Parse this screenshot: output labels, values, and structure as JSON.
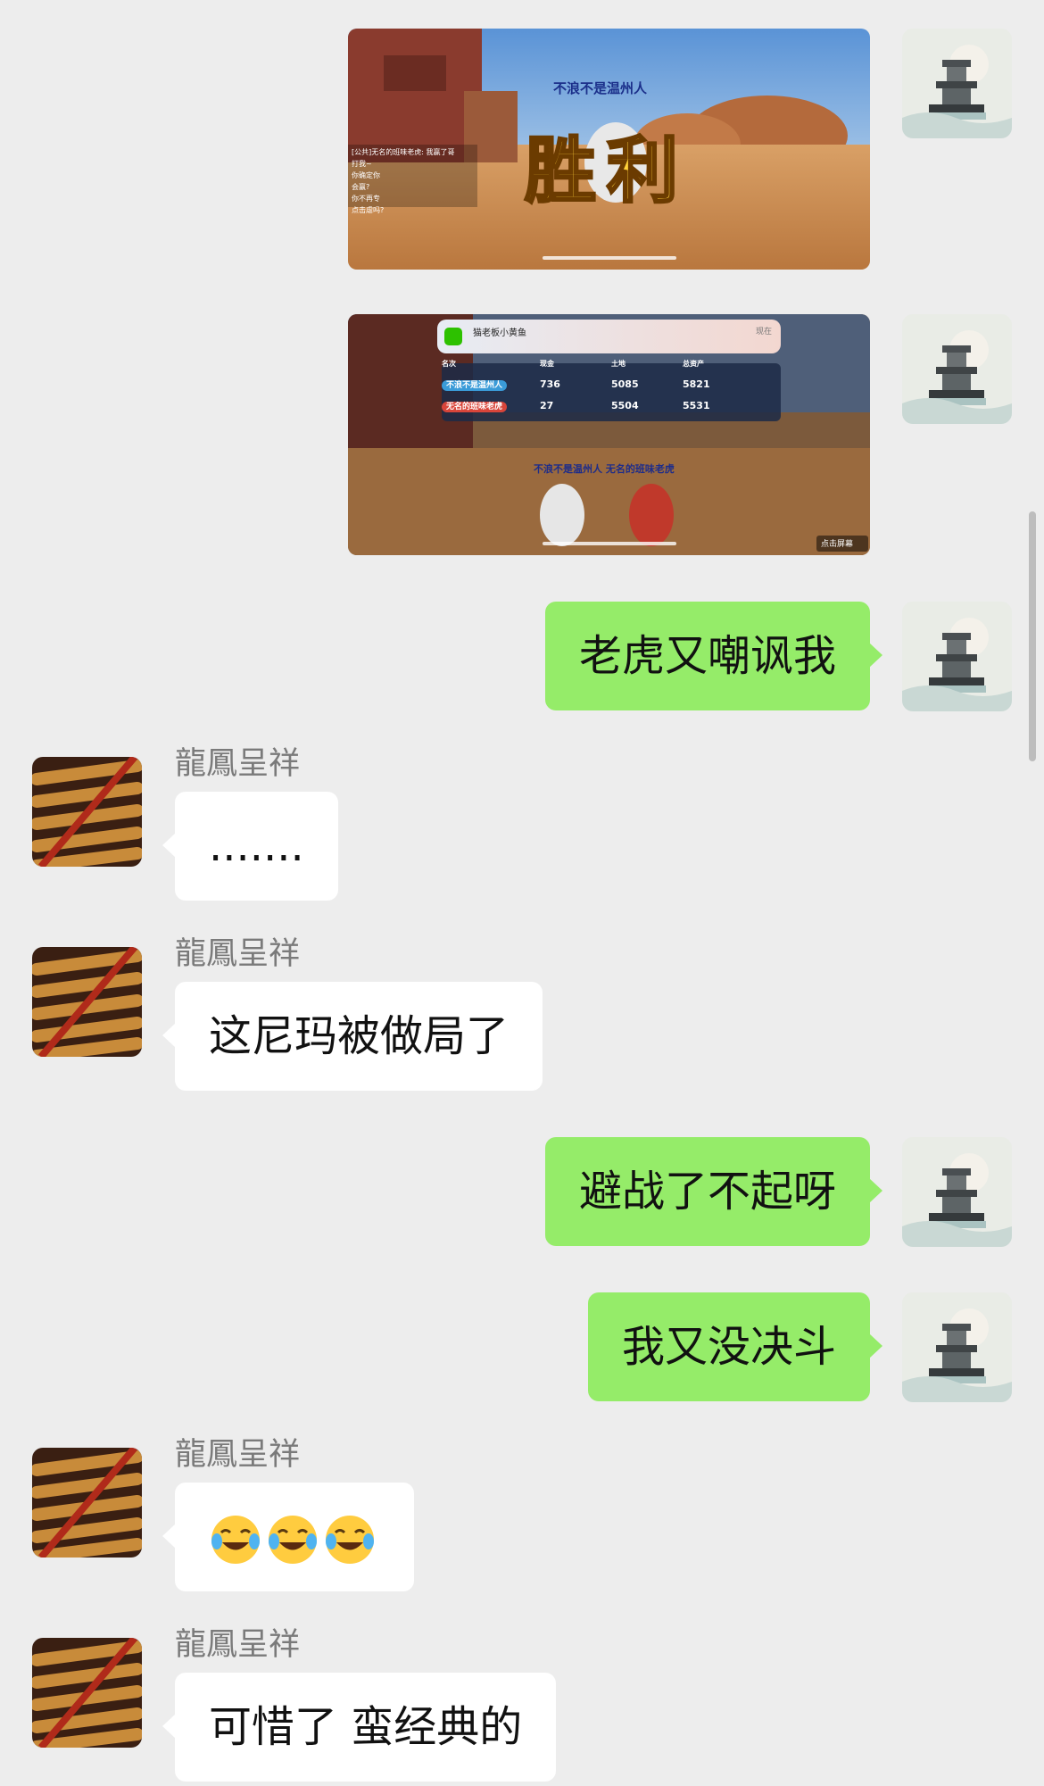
{
  "contact": {
    "name": "龍鳳呈祥"
  },
  "images": [
    {
      "banner": "不浪不是温州人",
      "big_text": "胜利",
      "chat_lines": [
        "[公共]无名的班味老虎: 我赢了哥",
        "打我~",
        "你确定你",
        "会赢?",
        "你不再专",
        "点击虐吗?"
      ]
    },
    {
      "notification": "猫老板小黄鱼",
      "notification_time": "现在",
      "table_headers": [
        "名次",
        "现金",
        "土地",
        "总资产"
      ],
      "rows": [
        {
          "name": "不浪不是温州人",
          "cash": "736",
          "land": "5085",
          "total": "5821"
        },
        {
          "name": "无名的班味老虎",
          "cash": "27",
          "land": "5504",
          "total": "5531"
        }
      ],
      "caption": "不浪不是温州人 无名的班味老虎",
      "corner": "点击屏幕"
    }
  ],
  "messages": [
    {
      "text": "老虎又嘲讽我"
    },
    {
      "text": "......."
    },
    {
      "text": "这尼玛被做局了"
    },
    {
      "text": "避战了不起呀"
    },
    {
      "text": "我又没决斗"
    },
    {
      "text": ""
    },
    {
      "text": "可惜了 蛮经典的"
    }
  ],
  "icons": {
    "my_avatar": "pagoda-avatar-icon",
    "their_avatar": "grilled-fish-avatar-icon",
    "emoji": "tears-of-joy-emoji-icon"
  }
}
